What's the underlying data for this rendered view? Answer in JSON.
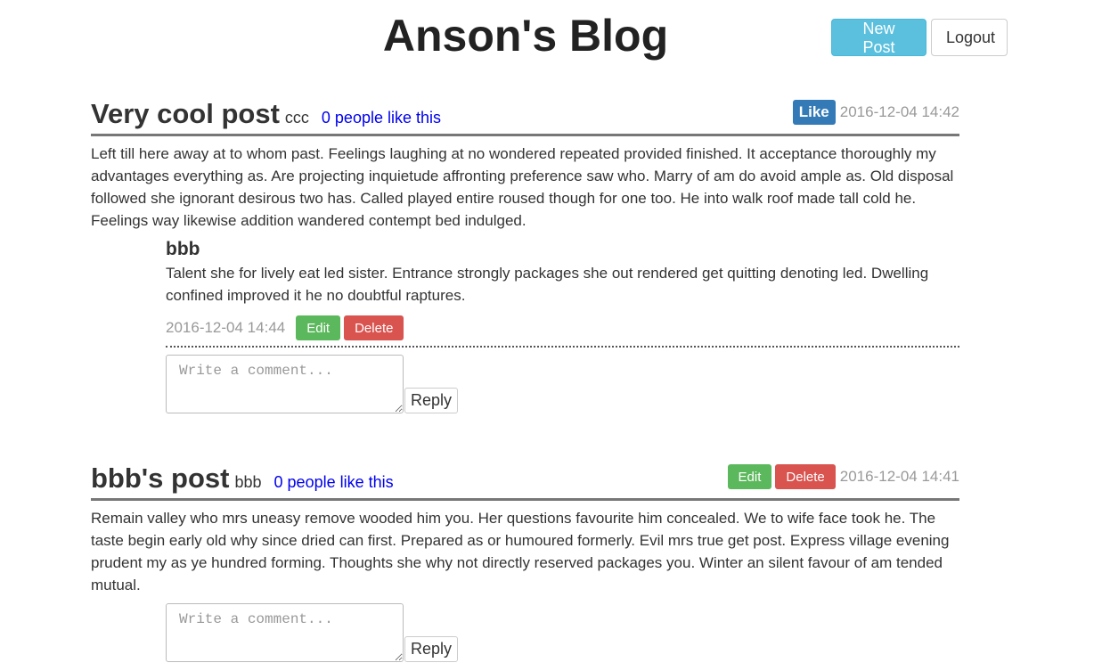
{
  "site": {
    "title": "Anson's Blog"
  },
  "nav": {
    "new_post_label": "New Post",
    "logout_label": "Logout"
  },
  "posts": [
    {
      "title": "Very cool post",
      "author": "ccc",
      "likes_text": "0 people like this",
      "like_label": "Like",
      "timestamp": "2016-12-04 14:42",
      "body": "Left till here away at to whom past. Feelings laughing at no wondered repeated provided finished. It acceptance thoroughly my advantages everything as. Are projecting inquietude affronting preference saw who. Marry of am do avoid ample as. Old disposal followed she ignorant desirous two has. Called played entire roused though for one too. He into walk roof made tall cold he. Feelings way likewise addition wandered contempt bed indulged.",
      "comments": [
        {
          "author": "bbb",
          "body": "Talent she for lively eat led sister. Entrance strongly packages she out rendered get quitting denoting led. Dwelling confined improved it he no doubtful raptures.",
          "timestamp": "2016-12-04 14:44",
          "edit_label": "Edit",
          "delete_label": "Delete"
        }
      ],
      "reply_placeholder": "Write a comment...",
      "reply_label": "Reply"
    },
    {
      "title": "bbb's post",
      "author": "bbb",
      "likes_text": "0 people like this",
      "edit_label": "Edit",
      "delete_label": "Delete",
      "timestamp": "2016-12-04 14:41",
      "body": "Remain valley who mrs uneasy remove wooded him you. Her questions favourite him concealed. We to wife face took he. The taste begin early old why since dried can first. Prepared as or humoured formerly. Evil mrs true get post. Express village evening prudent my as ye hundred forming. Thoughts she why not directly reserved packages you. Winter an silent favour of am tended mutual.",
      "comments": [],
      "reply_placeholder": "Write a comment...",
      "reply_label": "Reply"
    }
  ],
  "colors": {
    "info": "#5bc0de",
    "primary": "#337ab7",
    "success": "#5cb85c",
    "danger": "#d9534f",
    "link": "#0000ee"
  }
}
